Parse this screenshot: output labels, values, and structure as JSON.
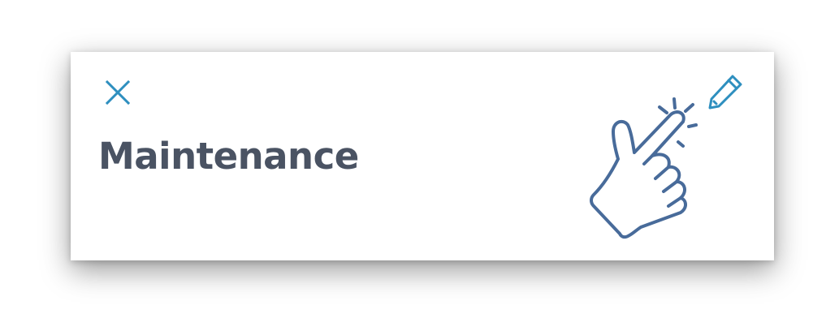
{
  "dialog": {
    "title": "Maintenance",
    "close_icon": "close-icon",
    "illustration_icon": "hand-tap-icon",
    "edit_icon": "pencil-icon"
  },
  "colors": {
    "title_text": "#4a5363",
    "accent_icon": "#2e8fbf",
    "illustration_stroke": "#486b9a"
  }
}
